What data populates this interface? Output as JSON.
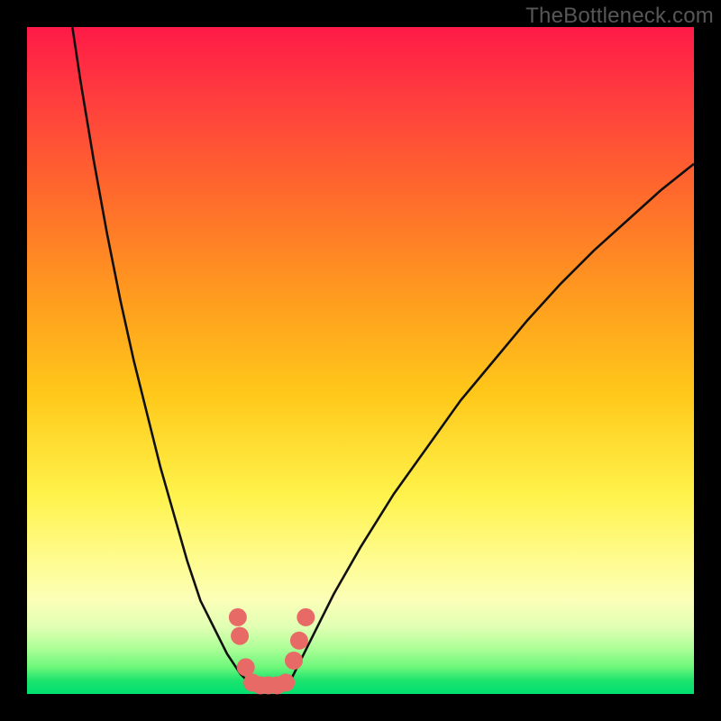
{
  "watermark": "TheBottleneck.com",
  "chart_data": {
    "type": "line",
    "title": "",
    "xlabel": "",
    "ylabel": "",
    "xlim": [
      0,
      100
    ],
    "ylim": [
      0,
      100
    ],
    "series": [
      {
        "name": "curve-left",
        "x": [
          6.8,
          8,
          10,
          12,
          14,
          16,
          18,
          20,
          22,
          24,
          25,
          26,
          27,
          28,
          29,
          30,
          31,
          32,
          32.5,
          33,
          33.5
        ],
        "y": [
          100,
          92,
          80,
          69,
          59,
          50,
          42,
          34,
          27,
          20,
          17,
          14,
          12,
          10,
          8,
          6,
          4.5,
          3,
          2.5,
          2,
          1.7
        ]
      },
      {
        "name": "curve-right",
        "x": [
          39,
          39.5,
          40,
          41,
          42,
          44,
          46,
          50,
          55,
          60,
          65,
          70,
          75,
          80,
          85,
          90,
          95,
          100
        ],
        "y": [
          1.7,
          2,
          3,
          5,
          7,
          11,
          15,
          22,
          30,
          37,
          44,
          50,
          56,
          61.5,
          66.5,
          71,
          75.5,
          79.5
        ]
      },
      {
        "name": "trough-floor",
        "x": [
          33.5,
          34,
          35,
          36,
          37,
          38,
          38.5,
          39
        ],
        "y": [
          1.7,
          1.5,
          1.3,
          1.3,
          1.3,
          1.3,
          1.5,
          1.7
        ]
      }
    ],
    "markers": [
      {
        "x": 31.6,
        "y": 11.5
      },
      {
        "x": 31.9,
        "y": 8.7
      },
      {
        "x": 32.8,
        "y": 4.0
      },
      {
        "x": 33.8,
        "y": 1.7
      },
      {
        "x": 35.0,
        "y": 1.3
      },
      {
        "x": 36.2,
        "y": 1.3
      },
      {
        "x": 37.5,
        "y": 1.3
      },
      {
        "x": 38.8,
        "y": 1.7
      },
      {
        "x": 40.0,
        "y": 5.0
      },
      {
        "x": 40.8,
        "y": 8.0
      },
      {
        "x": 41.8,
        "y": 11.5
      }
    ],
    "marker_radius": 1.35,
    "marker_color": "#e76a67",
    "curve_stroke": "#101010",
    "curve_width": 0.35,
    "floor_stroke": "#e76a67",
    "floor_width": 1.1
  }
}
